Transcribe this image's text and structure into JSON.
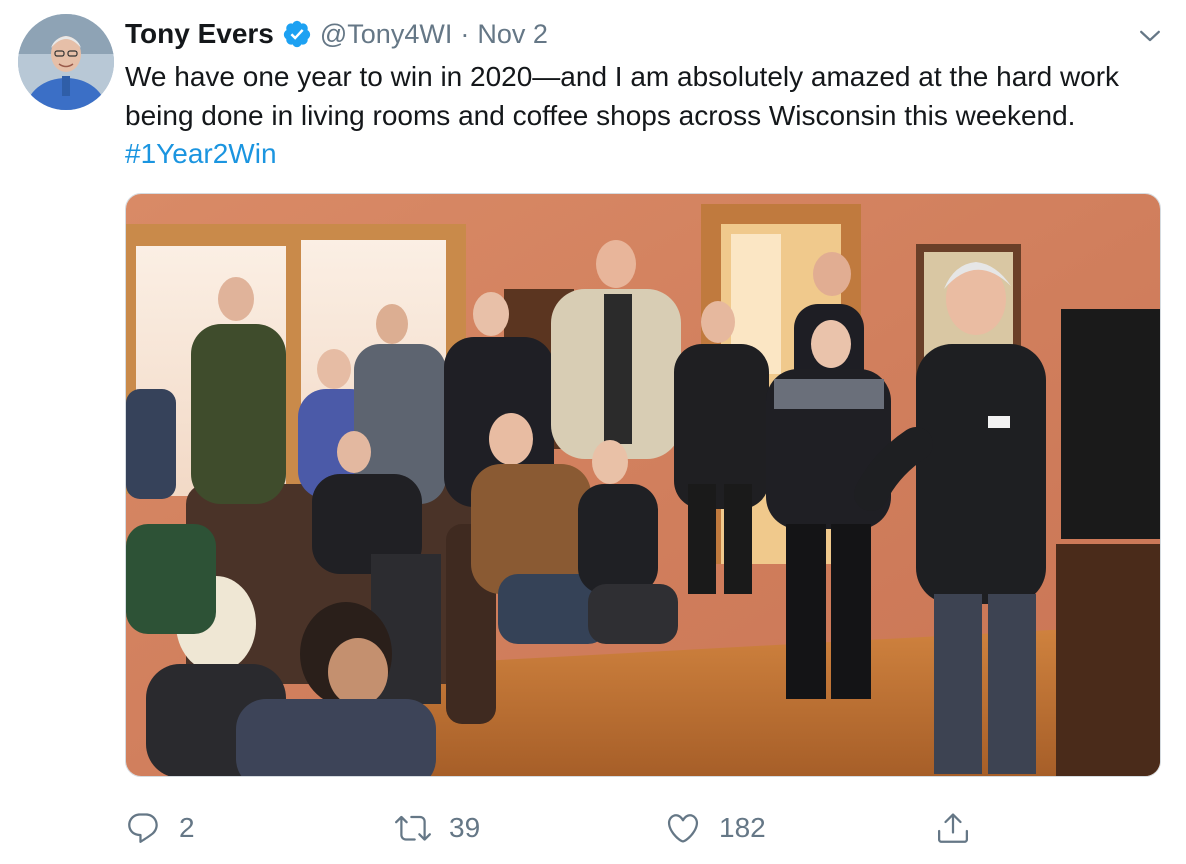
{
  "tweet": {
    "author": {
      "name": "Tony Evers",
      "handle": "@Tony4WI",
      "verified": true
    },
    "date_separator": "·",
    "date": "Nov 2",
    "text": "We have one year to win in 2020—and I am absolutely amazed at the hard work being done in living rooms and coffee shops across Wisconsin this weekend.",
    "hashtag": "#1Year2Win",
    "media": {
      "type": "photo",
      "subject": "crowd-in-living-room"
    },
    "actions": {
      "reply_count": "2",
      "retweet_count": "39",
      "like_count": "182"
    }
  },
  "icons": {
    "verified": "verified-badge-icon",
    "more": "chevron-down-icon",
    "reply": "reply-icon",
    "retweet": "retweet-icon",
    "like": "heart-icon",
    "share": "share-icon"
  },
  "colors": {
    "link": "#1b95e0",
    "secondary_text": "#657786",
    "primary_text": "#14171a",
    "verified": "#1da1f2"
  }
}
